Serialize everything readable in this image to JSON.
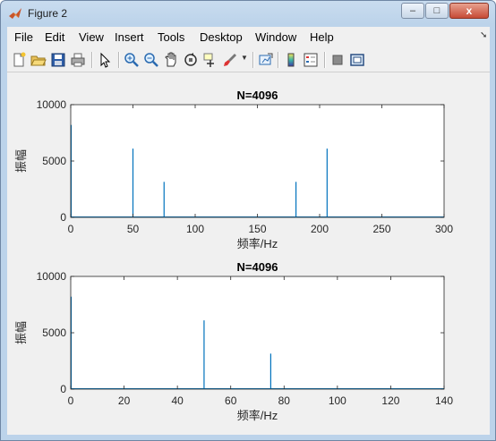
{
  "window": {
    "title": "Figure 2"
  },
  "titlebar": {
    "minimize_glyph": "–",
    "maximize_glyph": "□",
    "close_glyph": "x"
  },
  "menu": [
    "File",
    "Edit",
    "View",
    "Insert",
    "Tools",
    "Desktop",
    "Window",
    "Help"
  ],
  "toolbar": [
    "new-figure-icon",
    "open-file-icon",
    "save-icon",
    "print-icon",
    "pointer-icon",
    "zoom-in-icon",
    "zoom-out-icon",
    "pan-icon",
    "rotate-3d-icon",
    "data-cursor-icon",
    "brush-icon",
    "link-plot-icon",
    "insert-colorbar-icon",
    "insert-legend-icon",
    "hide-plot-tools-icon",
    "show-plot-tools-icon"
  ],
  "colors": {
    "line": "#0072bd",
    "canvas": "#f0f0f0",
    "axes_bg": "#ffffff"
  },
  "chart_data": [
    {
      "type": "line",
      "title": "N=4096",
      "xlabel": "频率/Hz",
      "ylabel": "振幅",
      "xlim": [
        0,
        300
      ],
      "ylim": [
        0,
        10000
      ],
      "xticks": [
        0,
        50,
        100,
        150,
        200,
        250,
        300
      ],
      "yticks": [
        0,
        5000,
        10000
      ],
      "peaks": [
        {
          "x": 0,
          "y": 8200
        },
        {
          "x": 50,
          "y": 6100
        },
        {
          "x": 75,
          "y": 3150
        },
        {
          "x": 181,
          "y": 3150
        },
        {
          "x": 206,
          "y": 6100
        }
      ]
    },
    {
      "type": "line",
      "title": "N=4096",
      "xlabel": "频率/Hz",
      "ylabel": "振幅",
      "xlim": [
        0,
        140
      ],
      "ylim": [
        0,
        10000
      ],
      "xticks": [
        0,
        20,
        40,
        60,
        80,
        100,
        120,
        140
      ],
      "yticks": [
        0,
        5000,
        10000
      ],
      "peaks": [
        {
          "x": 0,
          "y": 8200
        },
        {
          "x": 50,
          "y": 6100
        },
        {
          "x": 75,
          "y": 3150
        }
      ]
    }
  ]
}
